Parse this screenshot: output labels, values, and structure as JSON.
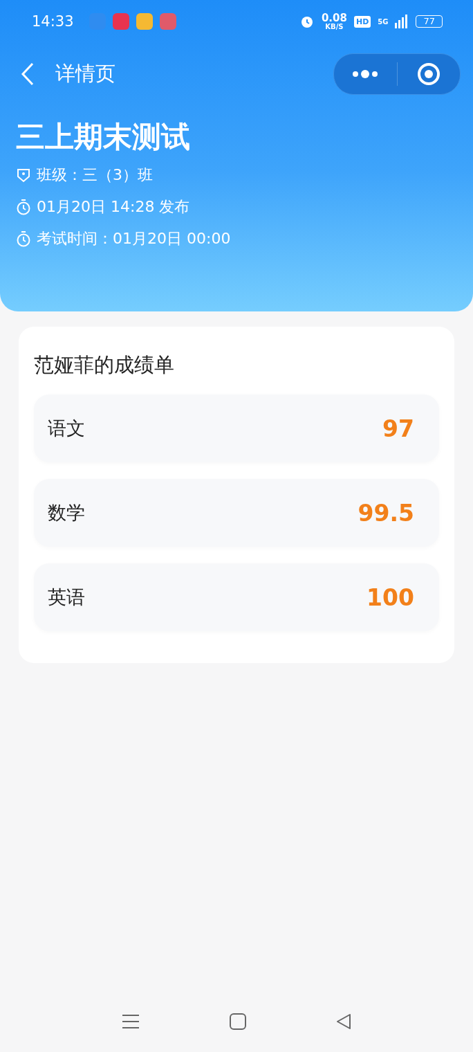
{
  "status_bar": {
    "time": "14:33",
    "apps": [
      {
        "color": "#2f8cf0"
      },
      {
        "color": "#e8334f"
      },
      {
        "color": "#f5b932"
      },
      {
        "color": "#e05a6a"
      }
    ],
    "speed": "0.08",
    "speed_unit": "KB/S",
    "hd": "HD",
    "network": "5G",
    "battery": "77"
  },
  "nav": {
    "title": "详情页"
  },
  "exam": {
    "title": "三上期末测试",
    "info": [
      {
        "kind": "class",
        "text": "班级：三（3）班"
      },
      {
        "kind": "time",
        "text": "01月20日 14:28 发布"
      },
      {
        "kind": "time",
        "text": "考试时间：01月20日 00:00"
      }
    ]
  },
  "report": {
    "title": "范娅菲的成绩单",
    "scores": [
      {
        "subject": "语文",
        "score": "97"
      },
      {
        "subject": "数学",
        "score": "99.5"
      },
      {
        "subject": "英语",
        "score": "100"
      }
    ]
  }
}
